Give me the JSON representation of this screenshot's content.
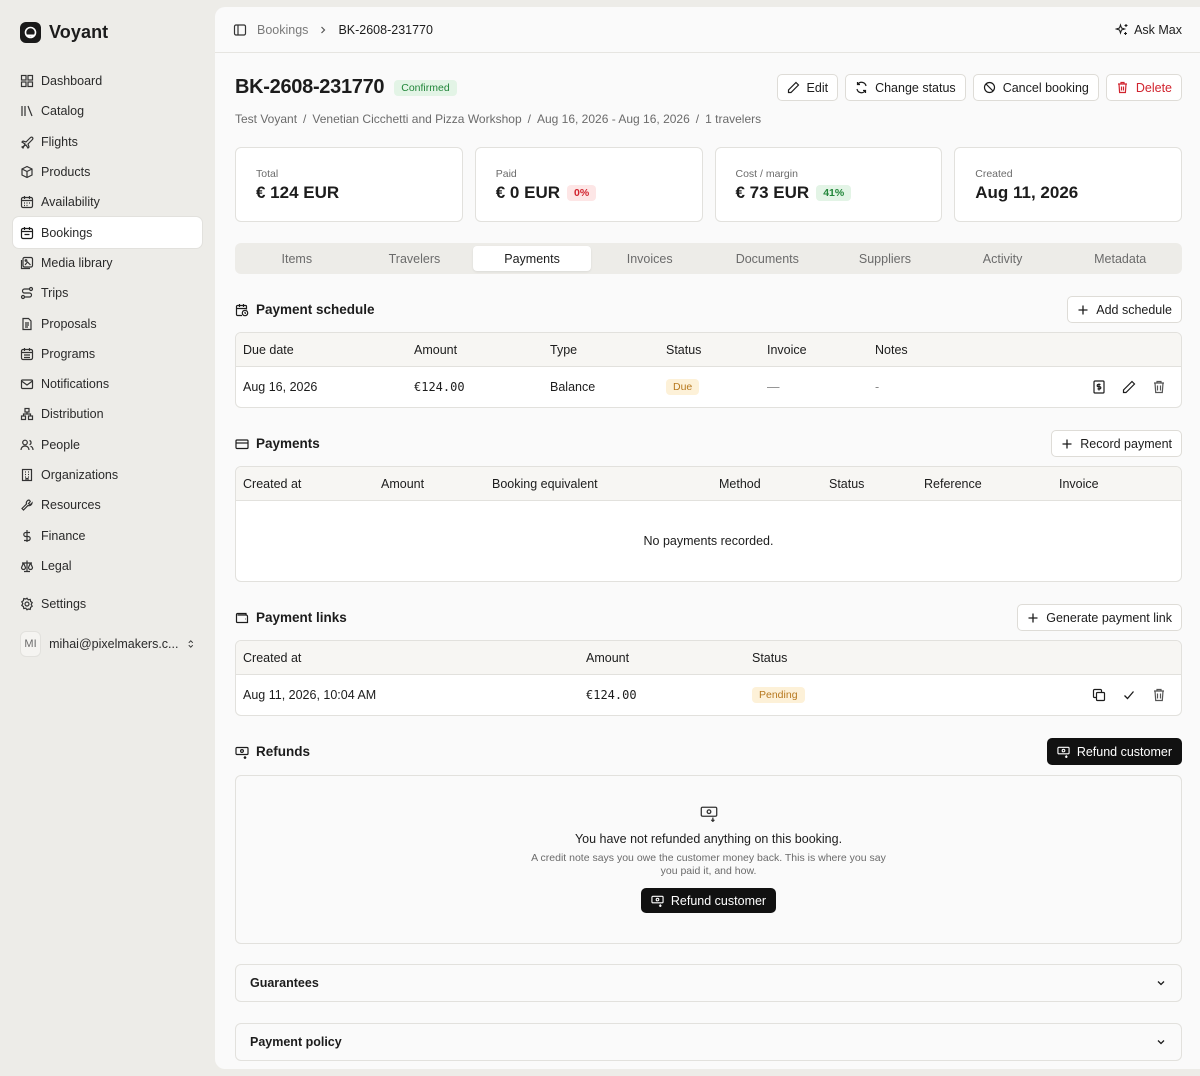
{
  "app": {
    "name": "Voyant"
  },
  "sidebar": {
    "items": [
      {
        "label": "Dashboard",
        "icon": "dashboard-icon"
      },
      {
        "label": "Catalog",
        "icon": "catalog-icon"
      },
      {
        "label": "Flights",
        "icon": "plane-icon"
      },
      {
        "label": "Products",
        "icon": "package-icon"
      },
      {
        "label": "Availability",
        "icon": "calendar-icon"
      },
      {
        "label": "Bookings",
        "icon": "calendar-check-icon",
        "active": true
      },
      {
        "label": "Media library",
        "icon": "images-icon"
      },
      {
        "label": "Trips",
        "icon": "route-icon"
      },
      {
        "label": "Proposals",
        "icon": "document-icon"
      },
      {
        "label": "Programs",
        "icon": "calendar-days-icon"
      },
      {
        "label": "Notifications",
        "icon": "mail-icon"
      },
      {
        "label": "Distribution",
        "icon": "network-icon"
      },
      {
        "label": "People",
        "icon": "users-icon"
      },
      {
        "label": "Organizations",
        "icon": "building-icon"
      },
      {
        "label": "Resources",
        "icon": "wrench-icon"
      },
      {
        "label": "Finance",
        "icon": "dollar-icon"
      },
      {
        "label": "Legal",
        "icon": "scale-icon"
      }
    ],
    "settings_label": "Settings",
    "user": {
      "initials": "MI",
      "email": "mihai@pixelmakers.c..."
    }
  },
  "topbar": {
    "crumb_parent": "Bookings",
    "crumb_current": "BK-2608-231770",
    "ask_label": "Ask Max"
  },
  "header": {
    "title": "BK-2608-231770",
    "status": "Confirmed",
    "sub": [
      "Test Voyant",
      "/",
      "Venetian Cicchetti and Pizza Workshop",
      "/",
      "Aug 16, 2026 - Aug 16, 2026",
      "/",
      "1 travelers"
    ],
    "actions": {
      "edit": "Edit",
      "change_status": "Change status",
      "cancel": "Cancel booking",
      "delete": "Delete"
    }
  },
  "stats": [
    {
      "label": "Total",
      "value": "€ 124 EUR",
      "badge": ""
    },
    {
      "label": "Paid",
      "value": "€ 0 EUR",
      "badge": "0%"
    },
    {
      "label": "Cost / margin",
      "value": "€ 73 EUR",
      "badge": "41%"
    },
    {
      "label": "Created",
      "value": "Aug 11, 2026",
      "badge": ""
    }
  ],
  "tabs": [
    "Items",
    "Travelers",
    "Payments",
    "Invoices",
    "Documents",
    "Suppliers",
    "Activity",
    "Metadata"
  ],
  "active_tab": "Payments",
  "schedule": {
    "title": "Payment schedule",
    "add_label": "Add schedule",
    "columns": [
      "Due date",
      "Amount",
      "Type",
      "Status",
      "Invoice",
      "Notes"
    ],
    "row": {
      "due": "Aug 16, 2026",
      "amount": "€124.00",
      "type": "Balance",
      "status": "Due",
      "invoice": "—",
      "notes": "-"
    }
  },
  "payments": {
    "title": "Payments",
    "add_label": "Record payment",
    "columns": [
      "Created at",
      "Amount",
      "Booking equivalent",
      "Method",
      "Status",
      "Reference",
      "Invoice"
    ],
    "empty": "No payments recorded."
  },
  "links": {
    "title": "Payment links",
    "add_label": "Generate payment link",
    "columns": [
      "Created at",
      "Amount",
      "Status"
    ],
    "row": {
      "created": "Aug 11, 2026, 10:04 AM",
      "amount": "€124.00",
      "status": "Pending"
    }
  },
  "refunds": {
    "title": "Refunds",
    "button_label": "Refund customer",
    "empty_title": "You have not refunded anything on this booking.",
    "empty_desc": "A credit note says you owe the customer money back. This is where you say you paid it, and how."
  },
  "collapsibles": {
    "guarantees": "Guarantees",
    "policy": "Payment policy"
  },
  "colors": {
    "accent_dark": "#111111",
    "success": "#22863a",
    "danger": "#d1242f",
    "warning": "#b7791f"
  }
}
